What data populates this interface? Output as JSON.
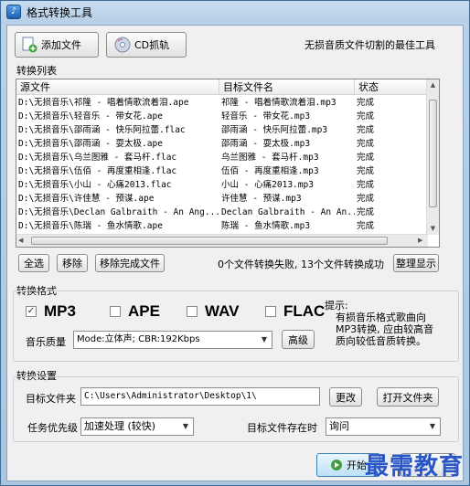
{
  "window": {
    "title": "格式转换工具"
  },
  "toolbar": {
    "add_file_label": "添加文件",
    "cd_rip_label": "CD抓轨",
    "slogan": "无损音质文件切割的最佳工具"
  },
  "conversion_list": {
    "group_label": "转换列表",
    "columns": [
      "源文件",
      "目标文件名",
      "状态"
    ],
    "rows": [
      [
        "D:\\无损音乐\\祁隆 - 唱着情歌流着泪.ape",
        "祁隆 - 唱着情歌流着泪.mp3",
        "完成"
      ],
      [
        "D:\\无损音乐\\轻音乐 - 带女花.ape",
        "轻音乐 - 带女花.mp3",
        "完成"
      ],
      [
        "D:\\无损音乐\\邵雨涵 - 快乐阿拉蕾.flac",
        "邵雨涵 - 快乐阿拉蕾.mp3",
        "完成"
      ],
      [
        "D:\\无损音乐\\邵雨涵 - 耍太极.ape",
        "邵雨涵 - 耍太极.mp3",
        "完成"
      ],
      [
        "D:\\无损音乐\\乌兰图雅 - 套马杆.flac",
        "乌兰图雅 - 套马杆.mp3",
        "完成"
      ],
      [
        "D:\\无损音乐\\伍佰 - 再度重相逢.flac",
        "伍佰 - 再度重相逢.mp3",
        "完成"
      ],
      [
        "D:\\无损音乐\\小山 - 心痛2013.flac",
        "小山 - 心痛2013.mp3",
        "完成"
      ],
      [
        "D:\\无损音乐\\许佳慧 - 预谋.ape",
        "许佳慧 - 预谋.mp3",
        "完成"
      ],
      [
        "D:\\无损音乐\\Declan Galbraith - An Ang...",
        "Declan Galbraith - An An...",
        "完成"
      ],
      [
        "D:\\无损音乐\\陈瑞 - 鱼水情歌.ape",
        "陈瑞 - 鱼水情歌.mp3",
        "完成"
      ]
    ]
  },
  "list_actions": {
    "select_all": "全选",
    "remove": "移除",
    "remove_done": "移除完成文件",
    "status_text": "0个文件转换失败, 13个文件转换成功",
    "organize": "整理显示"
  },
  "format": {
    "group_label": "转换格式",
    "options": [
      {
        "label": "MP3",
        "checked": true
      },
      {
        "label": "APE",
        "checked": false
      },
      {
        "label": "WAV",
        "checked": false
      },
      {
        "label": "FLAC",
        "checked": false
      }
    ],
    "quality_label": "音乐质量",
    "quality_value": "Mode:立体声; CBR:192Kbps",
    "advanced_label": "高级",
    "tip_title": "提示:",
    "tip_text": "有损音乐格式歌曲向MP3转换, 应由较高音质向较低音质转换。"
  },
  "settings": {
    "group_label": "转换设置",
    "target_folder_label": "目标文件夹",
    "target_folder_value": "C:\\Users\\Administrator\\Desktop\\1\\",
    "change_label": "更改",
    "open_folder_label": "打开文件夹",
    "priority_label": "任务优先级",
    "priority_value": "加速处理 (较快)",
    "exists_label": "目标文件存在时",
    "exists_value": "询问"
  },
  "footer": {
    "start_label": "开始",
    "watermark": "最需教育"
  }
}
